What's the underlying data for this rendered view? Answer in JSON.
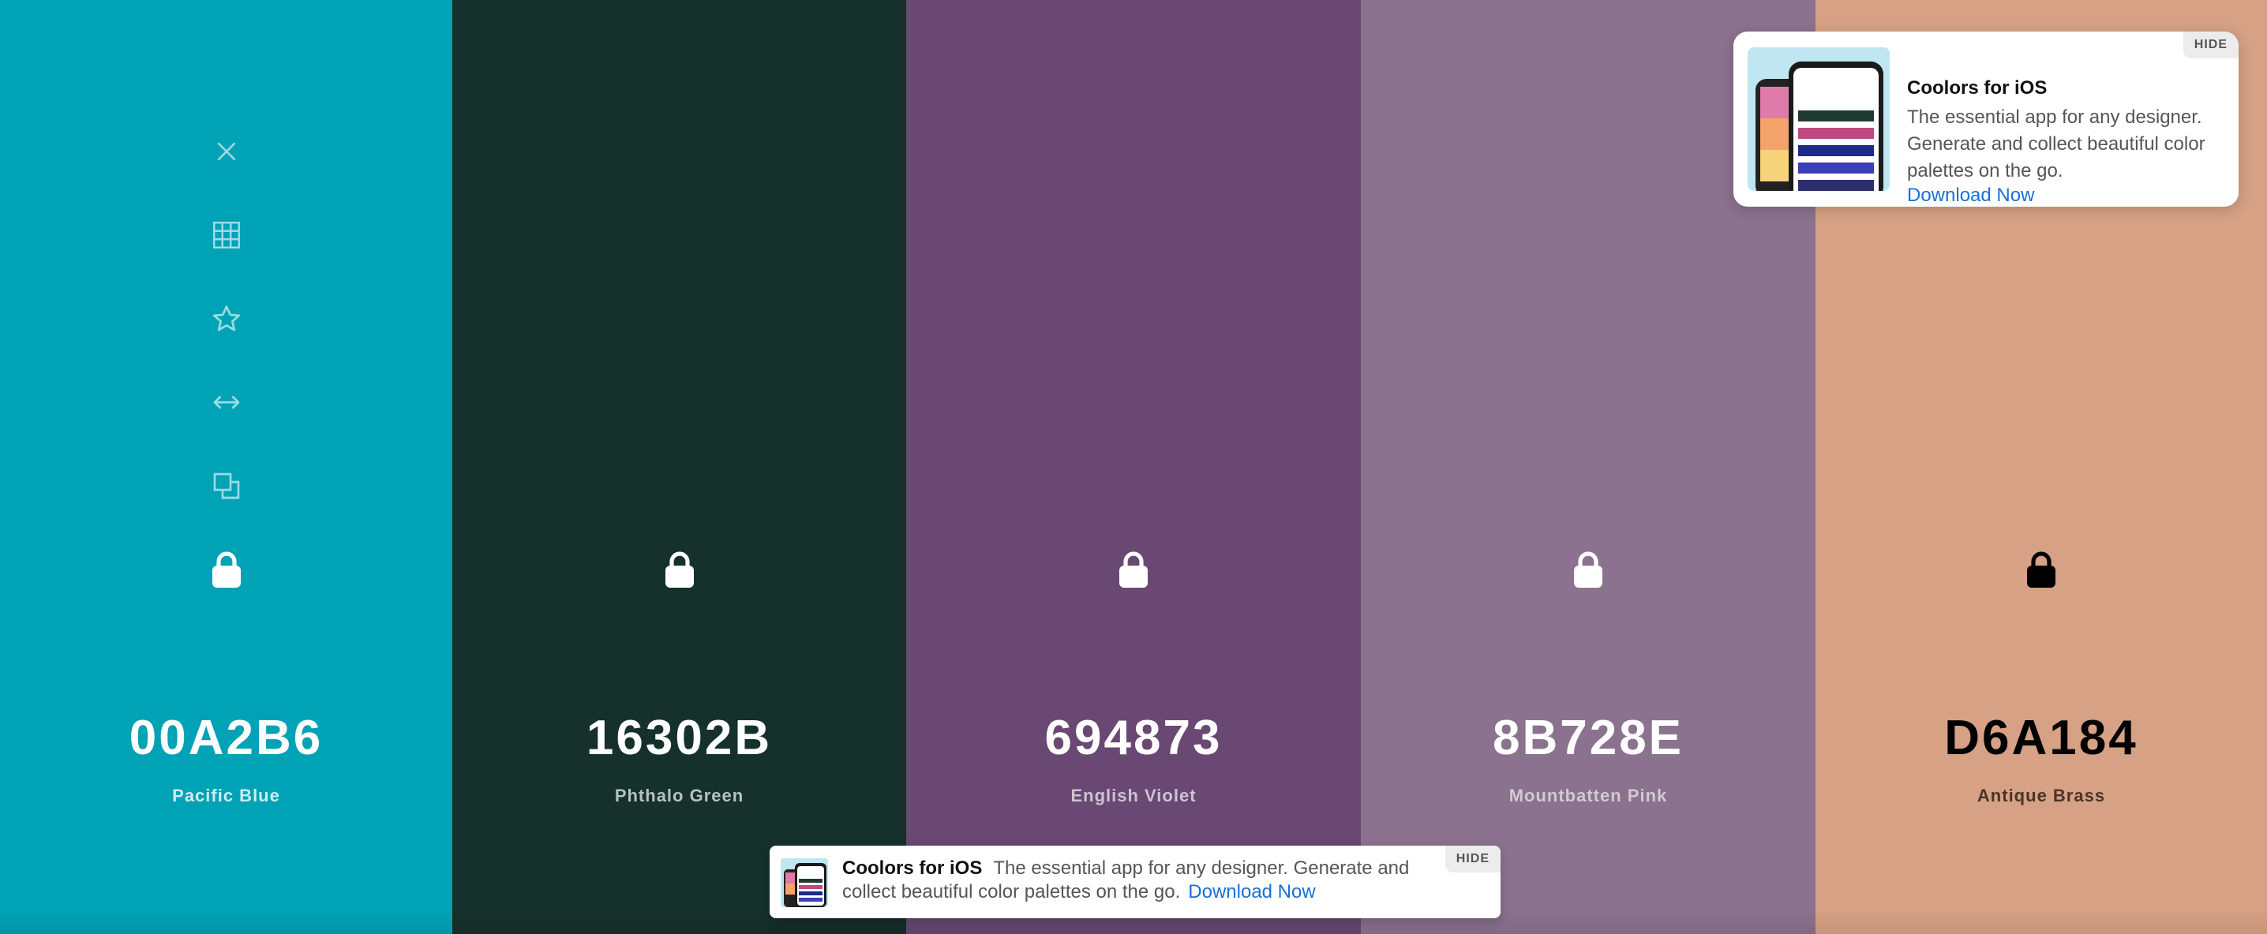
{
  "palette": {
    "colors": [
      {
        "hex": "00A2B6",
        "name": "Pacific Blue",
        "background": "#00A2B6",
        "hex_text_color": "#ffffff",
        "name_text_color": "#cdeef2",
        "lock_color": "#ffffff"
      },
      {
        "hex": "16302B",
        "name": "Phthalo Green",
        "background": "#16302B",
        "hex_text_color": "#ffffff",
        "name_text_color": "#b7c3c0",
        "lock_color": "#ffffff"
      },
      {
        "hex": "694873",
        "name": "English Violet",
        "background": "#694873",
        "hex_text_color": "#ffffff",
        "name_text_color": "#cfc3d3",
        "lock_color": "#ffffff"
      },
      {
        "hex": "8B728E",
        "name": "Mountbatten Pink",
        "background": "#8B728E",
        "hex_text_color": "#ffffff",
        "name_text_color": "#d2c9d3",
        "lock_color": "#ffffff"
      },
      {
        "hex": "D6A184",
        "name": "Antique Brass",
        "background": "#D6A184",
        "hex_text_color": "#000000",
        "name_text_color": "#4a3428",
        "lock_color": "#000000"
      }
    ],
    "toolbar_icons": [
      "close-icon",
      "grid-icon",
      "star-icon",
      "arrows-horizontal-icon",
      "copy-icon"
    ],
    "toolbar_icon_color": "#9fdbe3"
  },
  "ad_card": {
    "title": "Coolors for iOS",
    "description": "The essential app for any designer. Generate and collect beautiful color palettes on the go.",
    "link": "Download Now",
    "hide": "HIDE",
    "link_color": "#1a6fd8"
  },
  "ad_banner": {
    "title": "Coolors for iOS",
    "description": "The essential app for any designer. Generate and collect beautiful color palettes on the go.",
    "link": "Download Now",
    "hide": "HIDE"
  }
}
